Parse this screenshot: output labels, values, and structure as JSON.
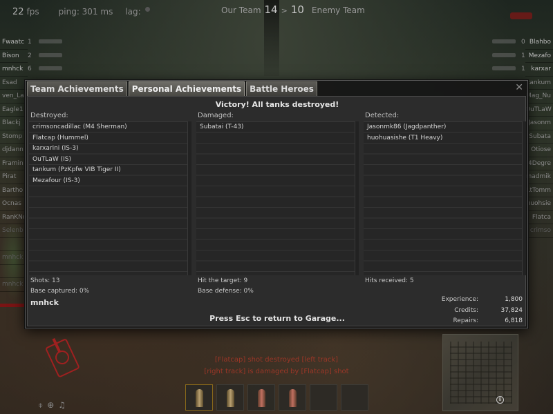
{
  "hud": {
    "fps_value": "22",
    "fps_unit": "fps",
    "ping": "ping: 301 ms",
    "lag": "lag:",
    "our_team_label": "Our Team",
    "our_score": "14",
    "score_separator": ">",
    "enemy_score": "10",
    "enemy_team_label": "Enemy Team"
  },
  "left_team": [
    {
      "name": "Fwaatc",
      "frags": "1"
    },
    {
      "name": "Bison",
      "frags": "2"
    },
    {
      "name": "mnhck",
      "frags": "6"
    },
    {
      "name": "Esad",
      "frags": ""
    },
    {
      "name": "ven_La",
      "frags": ""
    },
    {
      "name": "Eagle1",
      "frags": ""
    },
    {
      "name": "Blackj",
      "frags": ""
    },
    {
      "name": "Stomp",
      "frags": ""
    },
    {
      "name": "djdann",
      "frags": ""
    },
    {
      "name": "Framin",
      "frags": ""
    },
    {
      "name": "Pirat",
      "frags": ""
    },
    {
      "name": "Bartho",
      "frags": ""
    },
    {
      "name": "Ocnas",
      "frags": ""
    },
    {
      "name": "RanKNo",
      "frags": ""
    },
    {
      "name": "Selenb",
      "frags": ""
    },
    {
      "name": "",
      "frags": ""
    },
    {
      "name": "mnhck",
      "frags": ""
    },
    {
      "name": "",
      "frags": ""
    },
    {
      "name": "mnhck",
      "frags": ""
    }
  ],
  "right_team": [
    {
      "name": "Blahbo",
      "frags": "0"
    },
    {
      "name": "Mezafo",
      "frags": "1"
    },
    {
      "name": "karxar",
      "frags": "1"
    },
    {
      "name": "tankum",
      "frags": ""
    },
    {
      "name": "Mag_Nu",
      "frags": ""
    },
    {
      "name": "OuTLaW",
      "frags": ""
    },
    {
      "name": "Jasonm",
      "frags": ""
    },
    {
      "name": "Subata",
      "frags": ""
    },
    {
      "name": "Otiose",
      "frags": ""
    },
    {
      "name": "4Degre",
      "frags": ""
    },
    {
      "name": "madmik",
      "frags": ""
    },
    {
      "name": "LtTomm",
      "frags": ""
    },
    {
      "name": "huohsie",
      "frags": ""
    },
    {
      "name": "Flatca",
      "frags": ""
    },
    {
      "name": "crimso",
      "frags": ""
    }
  ],
  "dialog": {
    "tabs": [
      "Team Achievements",
      "Personal Achievements",
      "Battle Heroes"
    ],
    "active_tab": "Personal Achievements",
    "close_label": "✕",
    "victory_message": "Victory! All tanks destroyed!",
    "columns": [
      {
        "header": "Destroyed:",
        "items": [
          "crimsoncadillac (M4 Sherman)",
          "Flatcap (Hummel)",
          "karxarini (IS-3)",
          "OuTLaW (IS)",
          "tankum (PzKpfw VIB Tiger II)",
          "Mezafour (IS-3)"
        ]
      },
      {
        "header": "Damaged:",
        "items": [
          "Subatai (T-43)"
        ]
      },
      {
        "header": "Detected:",
        "items": [
          "Jasonmk86 (Jagdpanther)",
          "huohuasishe (T1 Heavy)"
        ]
      }
    ],
    "shots": "Shots: 13",
    "hit_target": "Hit the target: 9",
    "hits_received": "Hits received: 5",
    "base_captured": "Base captured: 0%",
    "base_defense": "Base defense: 0%",
    "player_name": "mnhck",
    "summary": [
      {
        "label": "Experience:",
        "value": "1,800"
      },
      {
        "label": "Credits:",
        "value": "37,824"
      },
      {
        "label": "Repairs:",
        "value": "6,818"
      }
    ],
    "esc_message": "Press Esc to return to Garage..."
  },
  "messages": [
    "[Flatcap] shot destroyed [left track]",
    "[right track] is damaged by [Flatcap] shot"
  ],
  "minimap_marker": "8",
  "colors": {
    "dialog_bg": "#161616",
    "tab_active": "#6e6d67",
    "message_red": "#aa3728"
  }
}
